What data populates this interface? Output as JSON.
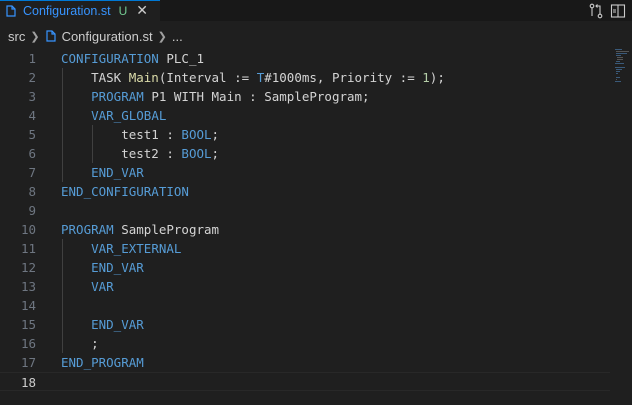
{
  "tab": {
    "filename": "Configuration.st",
    "status": "U",
    "close_icon": "close-icon",
    "file_icon": "file-icon"
  },
  "actions": {
    "compare_icon": "compare-changes-icon",
    "split_icon": "split-editor-icon"
  },
  "breadcrumb": {
    "folder": "src",
    "file": "Configuration.st",
    "more": "..."
  },
  "colors": {
    "accent": "#0078d4",
    "tab_text": "#3794ff",
    "untracked": "#73c991",
    "keyword": "#569cd6",
    "number": "#b5cea8"
  },
  "editor": {
    "current_line": 18,
    "lines": [
      {
        "num": "1",
        "tokens": [
          {
            "t": "CONFIGURATION",
            "c": "kw"
          },
          {
            "t": " PLC_1",
            "c": "pl"
          }
        ]
      },
      {
        "num": "2",
        "tokens": [
          {
            "t": "    TASK ",
            "c": "pl"
          },
          {
            "t": "Main",
            "c": "fn"
          },
          {
            "t": "(Interval := ",
            "c": "pl"
          },
          {
            "t": "T",
            "c": "kw"
          },
          {
            "t": "#1000ms, Priority := ",
            "c": "pl"
          },
          {
            "t": "1",
            "c": "num"
          },
          {
            "t": ");",
            "c": "pl"
          }
        ]
      },
      {
        "num": "3",
        "tokens": [
          {
            "t": "    ",
            "c": "pl"
          },
          {
            "t": "PROGRAM",
            "c": "kw"
          },
          {
            "t": " P1 WITH Main : SampleProgram;",
            "c": "pl"
          }
        ]
      },
      {
        "num": "4",
        "tokens": [
          {
            "t": "    ",
            "c": "pl"
          },
          {
            "t": "VAR_GLOBAL",
            "c": "kw"
          }
        ]
      },
      {
        "num": "5",
        "tokens": [
          {
            "t": "        test1 : ",
            "c": "pl"
          },
          {
            "t": "BOOL",
            "c": "kw"
          },
          {
            "t": ";",
            "c": "pl"
          }
        ]
      },
      {
        "num": "6",
        "tokens": [
          {
            "t": "        test2 : ",
            "c": "pl"
          },
          {
            "t": "BOOL",
            "c": "kw"
          },
          {
            "t": ";",
            "c": "pl"
          }
        ]
      },
      {
        "num": "7",
        "tokens": [
          {
            "t": "    ",
            "c": "pl"
          },
          {
            "t": "END_VAR",
            "c": "kw"
          }
        ]
      },
      {
        "num": "8",
        "tokens": [
          {
            "t": "END_CONFIGURATION",
            "c": "kw"
          }
        ]
      },
      {
        "num": "9",
        "tokens": []
      },
      {
        "num": "10",
        "tokens": [
          {
            "t": "PROGRAM",
            "c": "kw"
          },
          {
            "t": " SampleProgram",
            "c": "pl"
          }
        ]
      },
      {
        "num": "11",
        "tokens": [
          {
            "t": "    ",
            "c": "pl"
          },
          {
            "t": "VAR_EXTERNAL",
            "c": "kw"
          }
        ]
      },
      {
        "num": "12",
        "tokens": [
          {
            "t": "    ",
            "c": "pl"
          },
          {
            "t": "END_VAR",
            "c": "kw"
          }
        ]
      },
      {
        "num": "13",
        "tokens": [
          {
            "t": "    ",
            "c": "pl"
          },
          {
            "t": "VAR",
            "c": "kw"
          }
        ]
      },
      {
        "num": "14",
        "tokens": []
      },
      {
        "num": "15",
        "tokens": [
          {
            "t": "    ",
            "c": "pl"
          },
          {
            "t": "END_VAR",
            "c": "kw"
          }
        ]
      },
      {
        "num": "16",
        "tokens": [
          {
            "t": "    ;",
            "c": "pl"
          }
        ]
      },
      {
        "num": "17",
        "tokens": [
          {
            "t": "END_PROGRAM",
            "c": "kw"
          }
        ]
      },
      {
        "num": "18",
        "tokens": []
      }
    ]
  }
}
